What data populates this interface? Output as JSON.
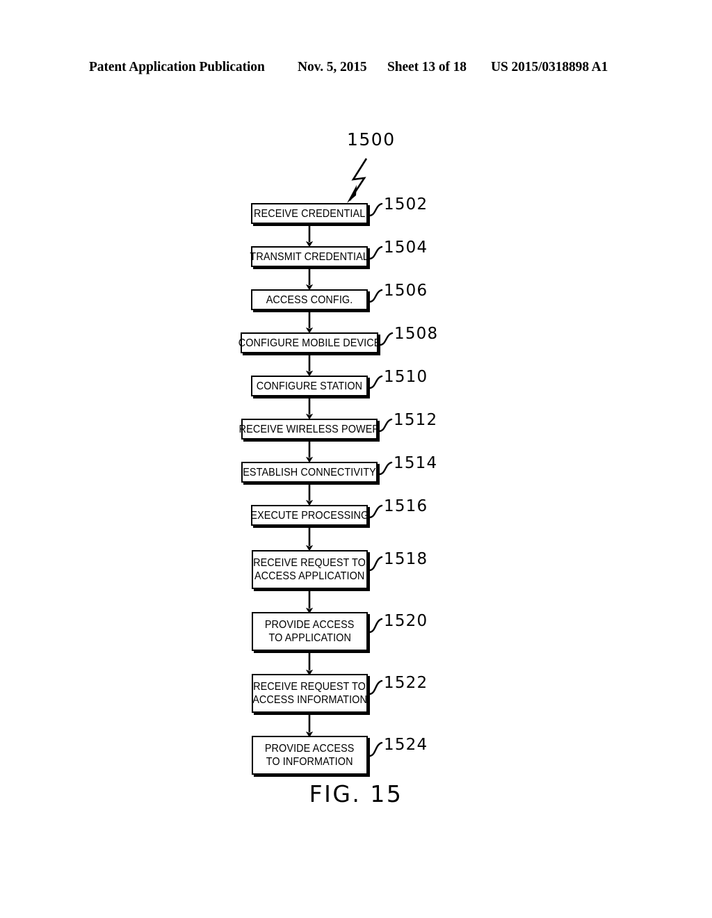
{
  "page": {
    "header": {
      "publication": "Patent Application Publication",
      "date": "Nov. 5, 2015",
      "sheet": "Sheet 13 of 18",
      "patent_number": "US 2015/0318898 A1"
    },
    "figure_caption": "FIG. 15",
    "background_color": "#ffffff",
    "ink_color": "#000000"
  },
  "figure": {
    "reference_numeral": "1500",
    "type": "flowchart",
    "orientation": "vertical",
    "steps": [
      {
        "ref": "1502",
        "lines": [
          "RECEIVE CREDENTIAL"
        ]
      },
      {
        "ref": "1504",
        "lines": [
          "TRANSMIT CREDENTIAL"
        ]
      },
      {
        "ref": "1506",
        "lines": [
          "ACCESS CONFIG."
        ]
      },
      {
        "ref": "1508",
        "lines": [
          "CONFIGURE MOBILE DEVICE"
        ]
      },
      {
        "ref": "1510",
        "lines": [
          "CONFIGURE STATION"
        ]
      },
      {
        "ref": "1512",
        "lines": [
          "RECEIVE WIRELESS POWER"
        ]
      },
      {
        "ref": "1514",
        "lines": [
          "ESTABLISH CONNECTIVITY"
        ]
      },
      {
        "ref": "1516",
        "lines": [
          "EXECUTE PROCESSING"
        ]
      },
      {
        "ref": "1518",
        "lines": [
          "RECEIVE REQUEST TO",
          "ACCESS APPLICATION"
        ]
      },
      {
        "ref": "1520",
        "lines": [
          "PROVIDE ACCESS",
          "TO APPLICATION"
        ]
      },
      {
        "ref": "1522",
        "lines": [
          "RECEIVE REQUEST TO",
          "ACCESS INFORMATION"
        ]
      },
      {
        "ref": "1524",
        "lines": [
          "PROVIDE ACCESS",
          "TO INFORMATION"
        ]
      }
    ]
  },
  "steps_text": {
    "s0_l0": "RECEIVE CREDENTIAL",
    "s1_l0": "TRANSMIT CREDENTIAL",
    "s2_l0": "ACCESS CONFIG.",
    "s3_l0": "CONFIGURE MOBILE DEVICE",
    "s4_l0": "CONFIGURE STATION",
    "s5_l0": "RECEIVE WIRELESS POWER",
    "s6_l0": "ESTABLISH CONNECTIVITY",
    "s7_l0": "EXECUTE PROCESSING",
    "s8_l0": "RECEIVE REQUEST TO",
    "s8_l1": "ACCESS APPLICATION",
    "s9_l0": "PROVIDE ACCESS",
    "s9_l1": "TO APPLICATION",
    "s10_l0": "RECEIVE REQUEST TO",
    "s10_l1": "ACCESS INFORMATION",
    "s11_l0": "PROVIDE ACCESS",
    "s11_l1": "TO INFORMATION"
  },
  "refs_text": {
    "r0": "1502",
    "r1": "1504",
    "r2": "1506",
    "r3": "1508",
    "r4": "1510",
    "r5": "1512",
    "r6": "1514",
    "r7": "1516",
    "r8": "1518",
    "r9": "1520",
    "r10": "1522",
    "r11": "1524",
    "figure_ref": "1500"
  }
}
